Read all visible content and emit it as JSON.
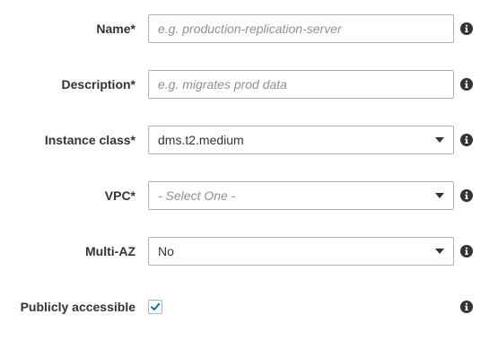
{
  "form": {
    "name": {
      "label": "Name*",
      "value": "",
      "placeholder": "e.g. production-replication-server"
    },
    "description": {
      "label": "Description*",
      "value": "",
      "placeholder": "e.g. migrates prod data"
    },
    "instance_class": {
      "label": "Instance class*",
      "selected": "dms.t2.medium"
    },
    "vpc": {
      "label": "VPC*",
      "selected": "- Select One -"
    },
    "multi_az": {
      "label": "Multi-AZ",
      "selected": "No"
    },
    "publicly_accessible": {
      "label": "Publicly accessible",
      "checked": true
    }
  },
  "icons": {
    "info": "info-icon",
    "dropdown": "caret-down-icon",
    "check": "check-icon"
  },
  "colors": {
    "input_border": "#aab7b8",
    "placeholder": "#8a9297",
    "checkmark": "#0073bb",
    "label_text": "#333333",
    "info_icon": "#333333"
  }
}
